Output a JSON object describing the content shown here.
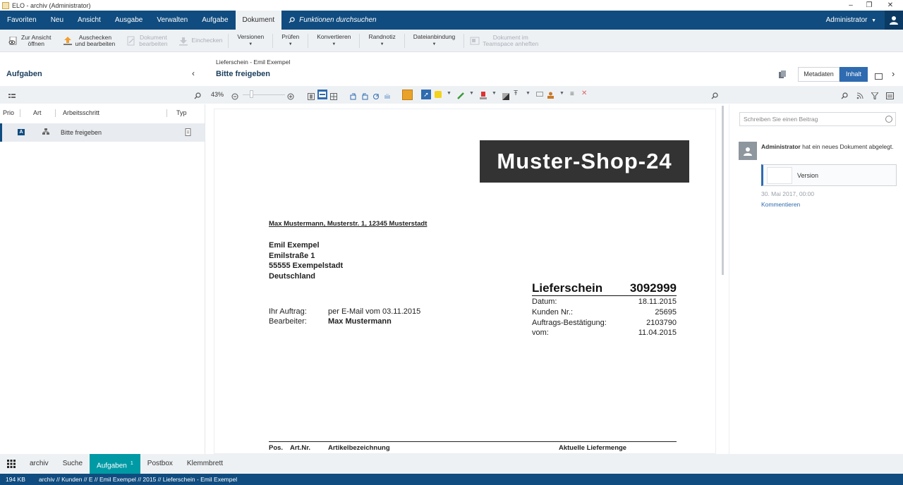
{
  "window": {
    "title": "ELO - archiv (Administrator)",
    "minimize": "–",
    "maximize": "❐",
    "close": "✕"
  },
  "ribbon": {
    "tabs": [
      "Favoriten",
      "Neu",
      "Ansicht",
      "Ausgabe",
      "Verwalten",
      "Aufgabe",
      "Dokument"
    ],
    "active_tab": "Dokument",
    "search_label": "Funktionen durchsuchen",
    "user": "Administrator"
  },
  "toolbar": {
    "zur_ansicht": [
      "Zur Ansicht",
      "öffnen"
    ],
    "auschecken": [
      "Auschecken",
      "und bearbeiten"
    ],
    "dokument_bearbeiten": [
      "Dokument",
      "bearbeiten"
    ],
    "einchecken": "Einchecken",
    "versionen": "Versionen",
    "pruefen": "Prüfen",
    "konvertieren": "Konvertieren",
    "randnotiz": "Randnotiz",
    "dateianbindung": "Dateianbindung",
    "teamspace": [
      "Dokument im",
      "Teamspace anheften"
    ]
  },
  "left_panel": {
    "title": "Aufgaben",
    "columns": [
      "Prio",
      "Art",
      "Arbeitsschritt",
      "Typ"
    ],
    "rows": [
      {
        "prio": "A",
        "step": "Bitte freigeben"
      }
    ]
  },
  "document_header": {
    "breadcrumb": "Lieferschein - Emil Exempel",
    "title": "Bitte freigeben",
    "seg_metadaten": "Metadaten",
    "seg_inhalt": "Inhalt"
  },
  "viewer": {
    "zoom": "43%",
    "zoom_level": 0.43
  },
  "document": {
    "logo": "Muster-Shop-24",
    "sender_line": "Max Mustermann, Musterstr. 1, 12345 Musterstadt",
    "recipient": [
      "Emil Exempel",
      "Emilstraße 1",
      "55555 Exempelstadt",
      "Deutschland"
    ],
    "doc_type": "Lieferschein",
    "doc_number": "3092999",
    "info_rows": [
      {
        "label": "Datum:",
        "value": "18.11.2015"
      },
      {
        "label": "Kunden Nr.:",
        "value": "25695"
      },
      {
        "label": "Auftrags-Bestätigung:",
        "value": "2103790"
      },
      {
        "label": "vom:",
        "value": "11.04.2015"
      }
    ],
    "auftrag_label": "Ihr Auftrag:",
    "auftrag_value": "per E-Mail  vom 03.11.2015",
    "bearbeiter_label": "Bearbeiter:",
    "bearbeiter_value": "Max Mustermann",
    "table_headers": [
      "Pos.",
      "Art.Nr.",
      "Artikelbezeichnung",
      "Aktuelle Liefermenge"
    ]
  },
  "right_panel": {
    "input_placeholder": "Schreiben Sie einen Beitrag",
    "feed_user": "Administrator",
    "feed_text": " hat ein neues Dokument abgelegt.",
    "version_label": "Version",
    "timestamp": "30. Mai 2017, 00:00",
    "comment_link": "Kommentieren"
  },
  "bottom_tabs": {
    "items": [
      "archiv",
      "Suche",
      "Aufgaben",
      "Postbox",
      "Klemmbrett"
    ],
    "active": "Aufgaben",
    "badge": "1"
  },
  "status_bar": {
    "size": "194 KB",
    "path": "archiv // Kunden // E // Emil Exempel // 2015 // Lieferschein - Emil Exempel"
  },
  "colors": {
    "brand": "#104c7f",
    "active_tab": "#009aa5",
    "segment_active": "#2f6bb0"
  }
}
